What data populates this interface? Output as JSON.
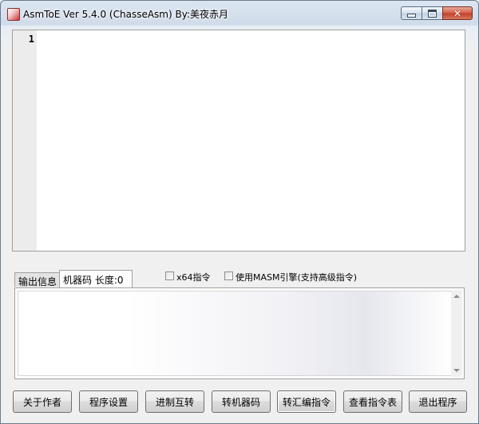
{
  "window": {
    "title": "AsmToE Ver 5.4.0 (ChasseAsm) By:美夜赤月",
    "icons": {
      "app": "app-icon",
      "minimize": "minimize-icon",
      "maximize": "maximize-icon",
      "close": "close-icon"
    }
  },
  "editor": {
    "line_numbers": [
      "1"
    ],
    "content": ""
  },
  "tabs": [
    {
      "label": "输出信息",
      "active": false
    },
    {
      "label": "机器码 长度:0",
      "active": true
    }
  ],
  "options": {
    "x64": {
      "label": "x64指令",
      "checked": false
    },
    "masm": {
      "label": "使用MASM引擎(支持高级指令)",
      "checked": false
    }
  },
  "output": {
    "content": ""
  },
  "buttons": {
    "about": "关于作者",
    "settings": "程序设置",
    "radix": "进制互转",
    "to_machine_code": "转机器码",
    "to_assembly": "转汇编指令",
    "view_table": "查看指令表",
    "exit": "退出程序"
  }
}
